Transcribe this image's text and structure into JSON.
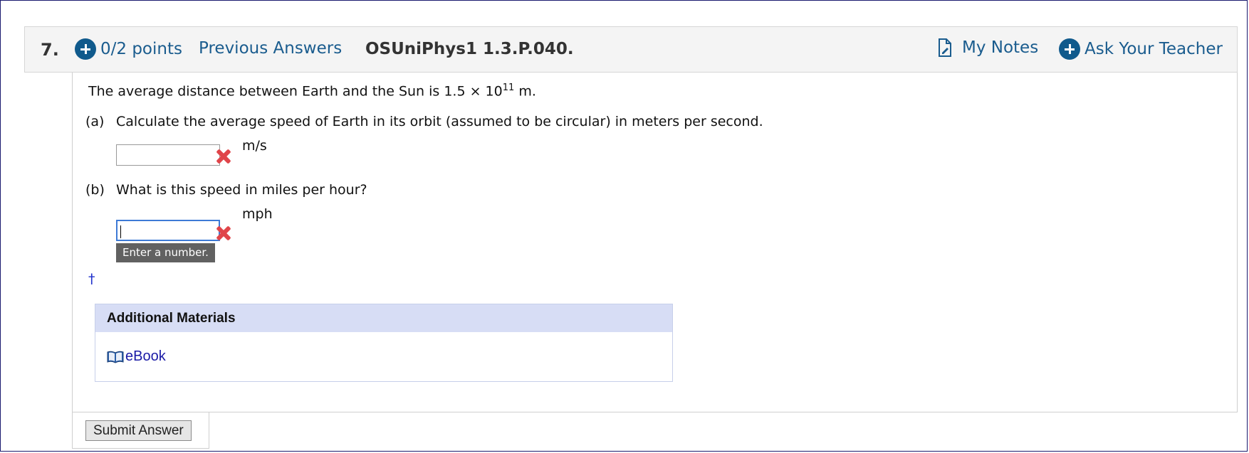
{
  "header": {
    "number": "7.",
    "points": "0/2 points",
    "previous_answers": "Previous Answers",
    "code": "OSUniPhys1 1.3.P.040.",
    "my_notes": "My Notes",
    "ask_teacher": "Ask Your Teacher"
  },
  "question": {
    "prompt_pre": "The average distance between Earth and the Sun is 1.5 × 10",
    "prompt_exp": "11",
    "prompt_post": " m.",
    "parts": [
      {
        "label": "(a)",
        "text": "Calculate the average speed of Earth in its orbit (assumed to be circular) in meters per second.",
        "value": "",
        "unit": "m/s"
      },
      {
        "label": "(b)",
        "text": "What is this speed in miles per hour?",
        "value": "",
        "unit": "mph",
        "tooltip": "Enter a number."
      }
    ],
    "dagger": "†"
  },
  "materials": {
    "title": "Additional Materials",
    "ebook": "eBook"
  },
  "submit_label": "Submit Answer",
  "colors": {
    "link": "#1a5c8e",
    "icon_bg": "#105a8c",
    "wrong_mark": "#e0454a",
    "materials_header": "#d7ddf5"
  },
  "icons": {
    "points": "plus-circle-icon",
    "notes": "note-page-icon",
    "ask": "plus-circle-icon",
    "wrong": "red-x-icon",
    "ebook": "open-book-icon"
  }
}
